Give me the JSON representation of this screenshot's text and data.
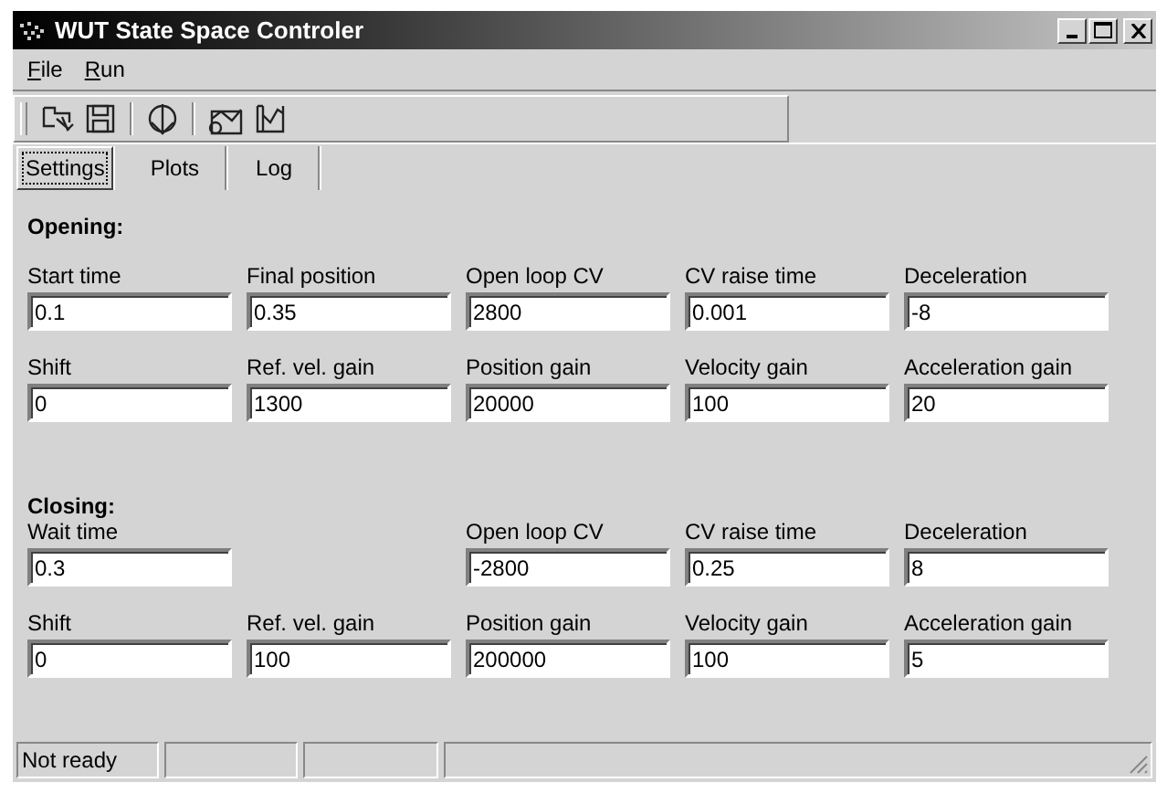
{
  "window": {
    "title": "WUT State Space Controler"
  },
  "menu": [
    "File",
    "Run"
  ],
  "tabs": [
    {
      "label": "Settings",
      "selected": true
    },
    {
      "label": "Plots",
      "selected": false
    },
    {
      "label": "Log",
      "selected": false
    }
  ],
  "sections": [
    {
      "title": "Opening:",
      "rows": [
        [
          {
            "label": "Start time",
            "value": "0.1"
          },
          {
            "label": "Final position",
            "value": "0.35"
          },
          {
            "label": "Open loop CV",
            "value": "2800"
          },
          {
            "label": "CV raise time",
            "value": "0.001"
          },
          {
            "label": "Deceleration",
            "value": "-8"
          }
        ],
        [
          {
            "label": "Shift",
            "value": "0"
          },
          {
            "label": "Ref. vel. gain",
            "value": "1300"
          },
          {
            "label": "Position gain",
            "value": "20000"
          },
          {
            "label": "Velocity gain",
            "value": "100"
          },
          {
            "label": "Acceleration gain",
            "value": "20"
          }
        ]
      ]
    },
    {
      "title": "Closing:",
      "rows": [
        [
          {
            "label": "Wait time",
            "value": "0.3"
          },
          null,
          {
            "label": "Open loop CV",
            "value": "-2800"
          },
          {
            "label": "CV raise time",
            "value": "0.25"
          },
          {
            "label": "Deceleration",
            "value": "8"
          }
        ],
        [
          {
            "label": "Shift",
            "value": "0"
          },
          {
            "label": "Ref. vel. gain",
            "value": "100"
          },
          {
            "label": "Position gain",
            "value": "200000"
          },
          {
            "label": "Velocity gain",
            "value": "100"
          },
          {
            "label": "Acceleration gain",
            "value": "5"
          }
        ]
      ]
    }
  ],
  "status_bar": {
    "text": "Not ready"
  }
}
